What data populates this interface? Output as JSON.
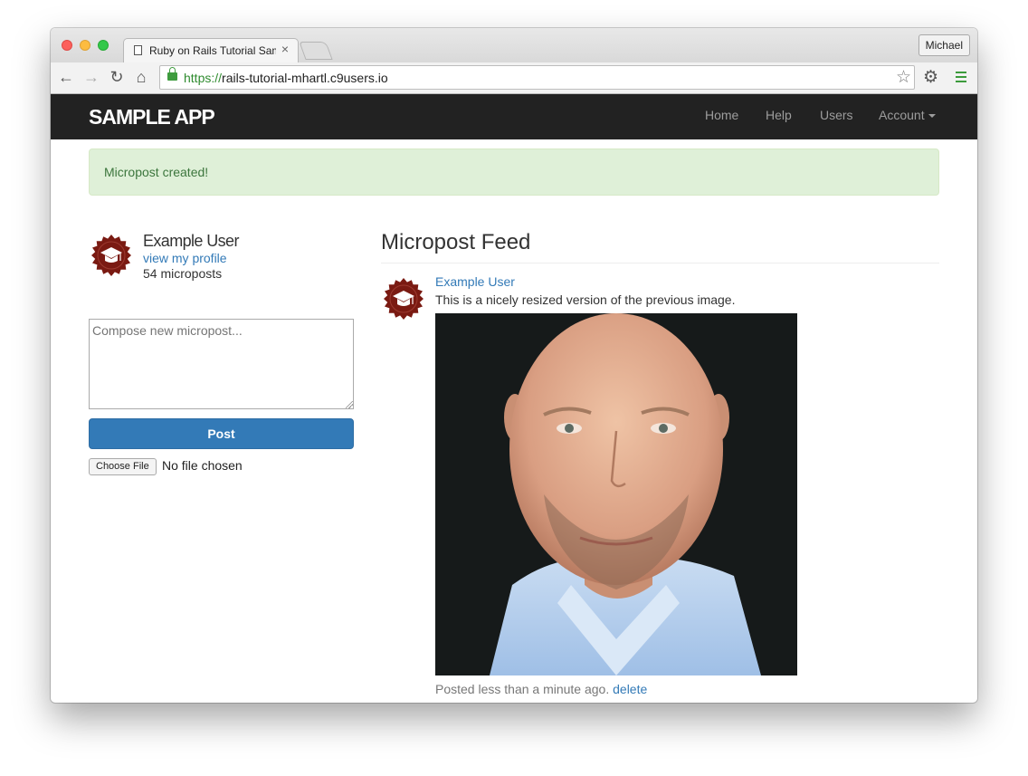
{
  "browser": {
    "tab_title": "Ruby on Rails Tutorial Sample App",
    "tab_close": "×",
    "profile_name": "Michael",
    "url_scheme": "https://",
    "url_host": "rails-tutorial-mhartl.c9users.io",
    "icons": [
      "back-icon",
      "forward-icon",
      "reload-icon",
      "home-icon",
      "lock-icon",
      "star-icon",
      "gear-icon",
      "menu-icon",
      "document-icon"
    ]
  },
  "header": {
    "logo": "SAMPLE APP",
    "nav": {
      "home": "Home",
      "help": "Help",
      "users": "Users",
      "account": "Account"
    }
  },
  "flash": {
    "message": "Micropost created!"
  },
  "sidebar": {
    "user_name": "Example User",
    "profile_link": "view my profile",
    "micropost_count": "54 microposts",
    "compose_placeholder": "Compose new micropost...",
    "post_button": "Post",
    "file_button": "Choose File",
    "file_status": "No file chosen"
  },
  "feed": {
    "title": "Micropost Feed",
    "items": [
      {
        "user": "Example User",
        "content": "This is a nicely resized version of the previous image.",
        "timestamp": "Posted less than a minute ago.",
        "delete_label": "delete"
      }
    ]
  },
  "colors": {
    "navbar": "#222222",
    "link": "#337ab7",
    "alert_bg": "#dff0d8",
    "alert_text": "#3c763d",
    "primary_button": "#337ab7",
    "gravatar": "#7a1a12"
  }
}
